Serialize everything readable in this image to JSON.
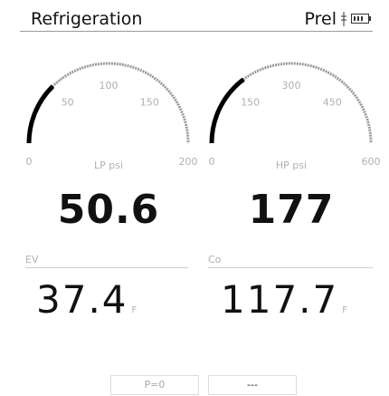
{
  "header": {
    "title": "Refrigeration",
    "mode_label": "Prel",
    "icons": {
      "probe": "probe-icon",
      "battery": "battery-icon"
    }
  },
  "gauges": [
    {
      "id": "lp",
      "label": "LP psi",
      "min": 0,
      "max": 200,
      "value": 50.6,
      "display_value": "50.6",
      "ticks": [
        "0",
        "50",
        "100",
        "150",
        "200"
      ]
    },
    {
      "id": "hp",
      "label": "HP psi",
      "min": 0,
      "max": 600,
      "value": 177,
      "display_value": "177",
      "ticks": [
        "0",
        "150",
        "300",
        "450",
        "600"
      ]
    }
  ],
  "temps": [
    {
      "label": "EV",
      "value": "37.4",
      "unit": "F"
    },
    {
      "label": "Co",
      "value": "117.7",
      "unit": "F"
    }
  ],
  "buttons": [
    {
      "label": "P=0"
    },
    {
      "label": "---"
    }
  ],
  "colors": {
    "arc_fill": "#000000",
    "arc_track": "#9a9a9a",
    "label_grey": "#b0b0b0"
  }
}
